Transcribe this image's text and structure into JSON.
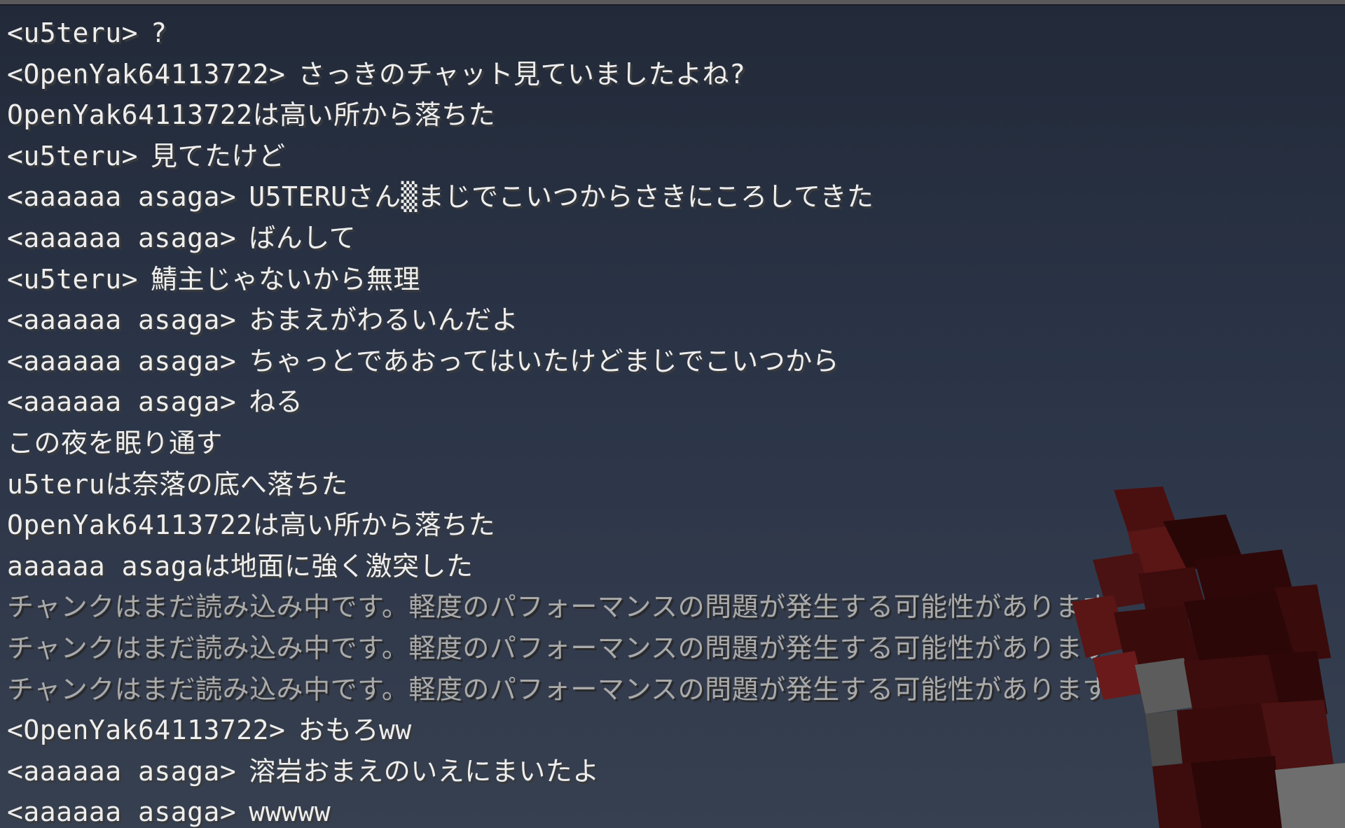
{
  "chat": {
    "lines": [
      {
        "sender": "<u5teru>",
        "message": "?",
        "style": "player"
      },
      {
        "sender": "<OpenYak64113722>",
        "message": "さっきのチャット見ていましたよね?",
        "style": "player"
      },
      {
        "sender": "",
        "message": "OpenYak64113722は高い所から落ちた",
        "style": "system"
      },
      {
        "sender": "<u5teru>",
        "message": "見てたけど",
        "style": "player"
      },
      {
        "sender": "<aaaaaa asaga>",
        "message": "U5TERUさん▒まじでこいつからさきにころしてきた",
        "style": "player"
      },
      {
        "sender": "<aaaaaa asaga>",
        "message": "ばんして",
        "style": "player"
      },
      {
        "sender": "<u5teru>",
        "message": "鯖主じゃないから無理",
        "style": "player"
      },
      {
        "sender": "<aaaaaa asaga>",
        "message": "おまえがわるいんだよ",
        "style": "player"
      },
      {
        "sender": "<aaaaaa asaga>",
        "message": "ちゃっとであおってはいたけどまじでこいつから",
        "style": "player"
      },
      {
        "sender": "<aaaaaa asaga>",
        "message": "ねる",
        "style": "player"
      },
      {
        "sender": "",
        "message": "この夜を眠り通す",
        "style": "system"
      },
      {
        "sender": "",
        "message": "u5teruは奈落の底へ落ちた",
        "style": "system"
      },
      {
        "sender": "",
        "message": "OpenYak64113722は高い所から落ちた",
        "style": "system"
      },
      {
        "sender": "",
        "message": "aaaaaa asagaは地面に強く激突した",
        "style": "system"
      },
      {
        "sender": "",
        "message": "チャンクはまだ読み込み中です。軽度のパフォーマンスの問題が発生する可能性があります",
        "style": "system-gray"
      },
      {
        "sender": "",
        "message": "チャンクはまだ読み込み中です。軽度のパフォーマンスの問題が発生する可能性があります",
        "style": "system-gray"
      },
      {
        "sender": "",
        "message": "チャンクはまだ読み込み中です。軽度のパフォーマンスの問題が発生する可能性があります",
        "style": "system-gray"
      },
      {
        "sender": "<OpenYak64113722>",
        "message": "おもろww",
        "style": "player"
      },
      {
        "sender": "<aaaaaa asaga>",
        "message": "溶岩おまえのいえにまいたよ",
        "style": "player"
      },
      {
        "sender": "<aaaaaa asaga>",
        "message": "wwwww",
        "style": "player"
      }
    ]
  },
  "colors": {
    "chat_text": "#eeeeee",
    "chat_text_gray": "#aaaaaa",
    "sky_top": "#2a3344",
    "sky_bottom": "#4a5568",
    "held_item_dark_red": "#3a0b0b",
    "held_item_red": "#5a1515",
    "held_item_gray": "#5c5c5c"
  },
  "icons": {
    "held_item": "held-item-icon"
  }
}
